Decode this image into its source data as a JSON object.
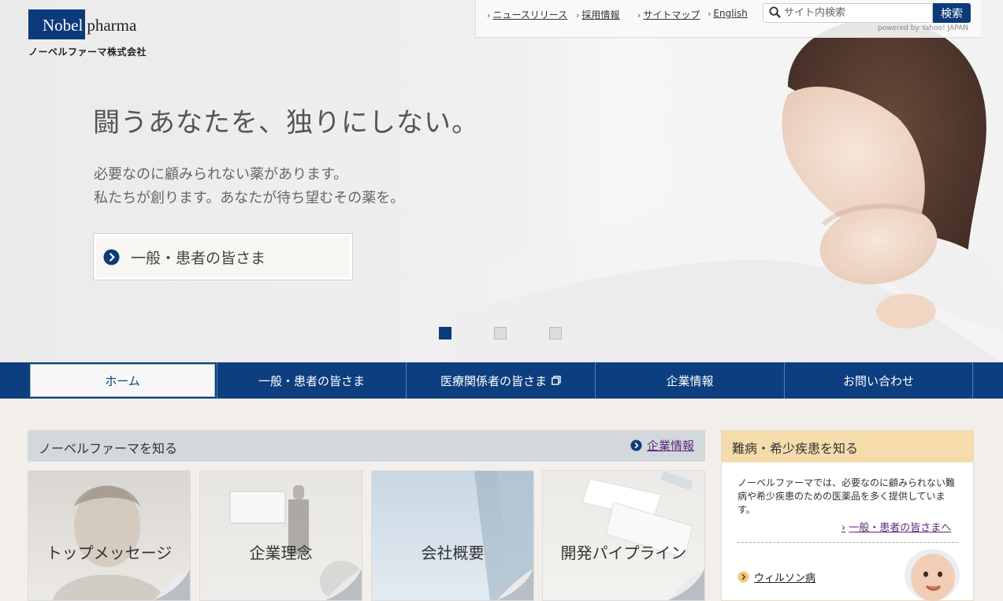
{
  "logo": {
    "name_box": "Nobel",
    "name_rest": "pharma",
    "subtitle": "ノーベルファーマ株式会社"
  },
  "util": {
    "links": [
      "ニュースリリース",
      "採用情報",
      "サイトマップ",
      "English"
    ],
    "search_placeholder": "サイト内検索",
    "search_button": "検索",
    "powered_by": "powered by Yahoo! JAPAN"
  },
  "hero": {
    "headline": "闘うあなたを、独りにしない。",
    "subline_1": "必要なのに顧みられない薬があります。",
    "subline_2": "私たちが創ります。あなたが待ち望むその薬を。",
    "cta_label": "一般・患者の皆さま",
    "active_slide": 1,
    "slides": 3
  },
  "nav": {
    "items": [
      {
        "label": "ホーム"
      },
      {
        "label": "一般・患者の皆さま"
      },
      {
        "label": "医療関係者の皆さま"
      },
      {
        "label": "企業情報"
      },
      {
        "label": "お問い合わせ"
      }
    ]
  },
  "about": {
    "title": "ノーベルファーマを知る",
    "link": "企業情報",
    "cards": [
      "トップメッセージ",
      "企業理念",
      "会社概要",
      "開発パイプライン"
    ]
  },
  "sidebar": {
    "title": "難病・希少疾患を知る",
    "text": "ノーベルファーマでは、必要なのに顧みられない難病や希少疾患のための医薬品を多く提供しています。",
    "link": "一般・患者の皆さまへ",
    "disease": "ウィルソン病"
  },
  "colors": {
    "brand_navy": "#0d3f80",
    "sidebar_head": "#f6dcab",
    "link_purple": "#5a2a7a"
  }
}
